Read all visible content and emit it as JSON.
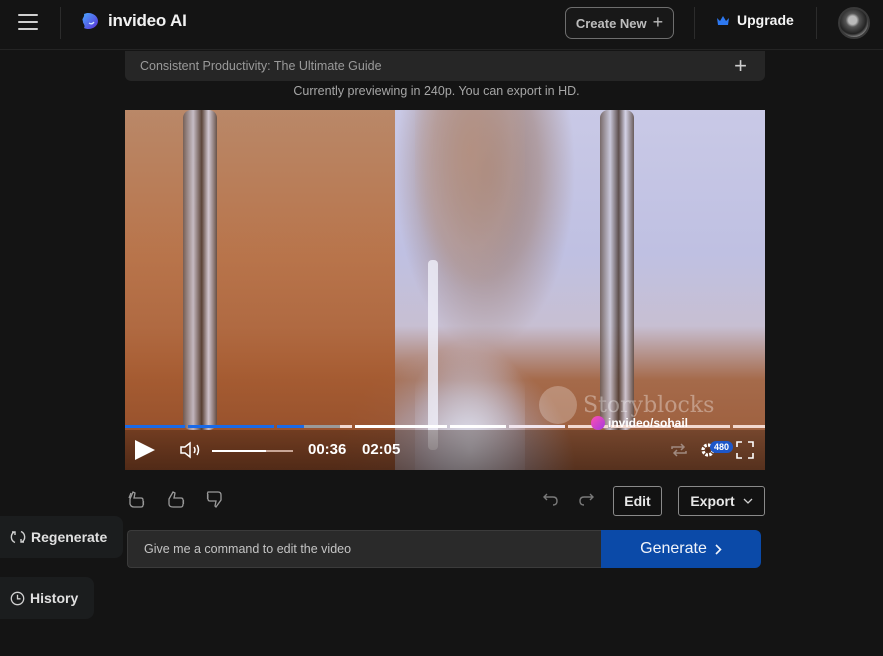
{
  "header": {
    "brand": "invideo AI",
    "create_new_label": "Create New",
    "create_new_icon": "plus-icon",
    "upgrade_label": "Upgrade",
    "upgrade_icon": "crown-icon",
    "menu_icon": "hamburger-menu-icon",
    "avatar_icon": "user-avatar"
  },
  "project": {
    "title": "Consistent Productivity: The Ultimate Guide",
    "add_icon": "plus-icon",
    "preview_note": "Currently previewing in 240p. You can export in HD."
  },
  "player": {
    "watermark": "Storyblocks",
    "handle": "invideo/sohail",
    "current_time": "00:36",
    "duration": "02:05",
    "volume_level": 0.67,
    "quality_badge": "480",
    "progress_played_fraction": 0.29,
    "controls": {
      "play_icon": "play-icon",
      "volume_icon": "volume-icon",
      "loop_icon": "loop-icon",
      "settings_icon": "gear-icon",
      "fullscreen_icon": "fullscreen-icon"
    },
    "accent": "#1a6ae8"
  },
  "actions": {
    "feedback_icons": [
      "clap-icon",
      "thumbs-up-icon",
      "thumbs-down-icon"
    ],
    "undo_icon": "undo-icon",
    "redo_icon": "redo-icon",
    "edit_label": "Edit",
    "export_label": "Export",
    "export_icon": "chevron-down-icon"
  },
  "command": {
    "placeholder": "Give me a command to edit the video",
    "value": "",
    "generate_label": "Generate",
    "generate_icon": "chevron-right-icon",
    "generate_color": "#0b4aa8"
  },
  "sidebar": {
    "regenerate_label": "Regenerate",
    "regenerate_icon": "refresh-icon",
    "history_label": "History",
    "history_icon": "clock-icon"
  }
}
